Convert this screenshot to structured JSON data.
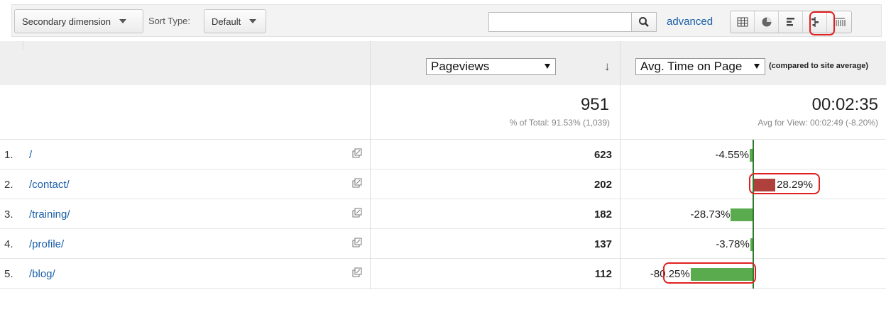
{
  "toolbar": {
    "secondary_dimension_label": "Secondary dimension",
    "sort_type_label": "Sort Type:",
    "sort_type_value": "Default",
    "search_placeholder": "",
    "advanced_label": "advanced",
    "view_icons": [
      "table-view-icon",
      "pie-view-icon",
      "performance-view-icon",
      "comparison-view-icon",
      "pivot-view-icon"
    ]
  },
  "header": {
    "primary_metric": "Pageviews",
    "compare_metric": "Avg. Time on Page",
    "compare_note": "(compared to site average)",
    "sort_indicator": "↓"
  },
  "totals": {
    "pageviews": "951",
    "pageviews_sub": "% of Total: 91.53% (1,039)",
    "avg_time": "00:02:35",
    "avg_time_sub": "Avg for View: 00:02:49 (-8.20%)"
  },
  "rows": [
    {
      "num": "1.",
      "page": "/",
      "pageviews": "623",
      "pct_text": "-4.55%",
      "pct_value": -4.55
    },
    {
      "num": "2.",
      "page": "/contact/",
      "pageviews": "202",
      "pct_text": "28.29%",
      "pct_value": 28.29
    },
    {
      "num": "3.",
      "page": "/training/",
      "pageviews": "182",
      "pct_text": "-28.73%",
      "pct_value": -28.73
    },
    {
      "num": "4.",
      "page": "/profile/",
      "pageviews": "137",
      "pct_text": "-3.78%",
      "pct_value": -3.78
    },
    {
      "num": "5.",
      "page": "/blog/",
      "pageviews": "112",
      "pct_text": "-80.25%",
      "pct_value": -80.25
    }
  ],
  "colors": {
    "positive_bar": "#b0403c",
    "negative_bar": "#5aaa4e",
    "link": "#1a5fa8",
    "highlight": "#e02020"
  }
}
